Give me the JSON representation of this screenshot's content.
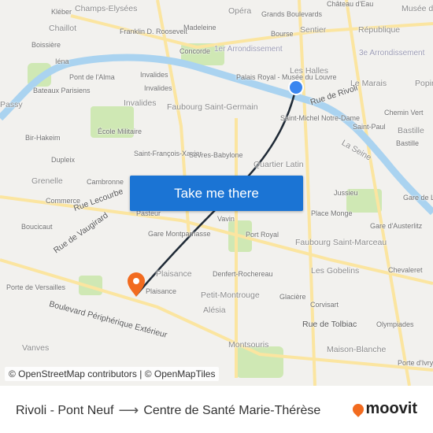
{
  "map": {
    "labels": [
      "Kléber",
      "Champs-Elysées",
      "Opéra",
      "Grands Boulevards",
      "Château d'Eau",
      "Musée du Temple",
      "Chaillot",
      "Franklin D. Roosevelt",
      "Madeleine",
      "Bourse",
      "Sentier",
      "République",
      "Boissière",
      "Concorde",
      "1er Arrondissement",
      "3e Arrondissement",
      "Iéna",
      "Les Halles",
      "Pont de l'Alma",
      "Invalides",
      "Invalides",
      "Palais Royal - Musée du Louvre",
      "Le Marais",
      "Bateaux Parisiens",
      "Rue de Rivoli",
      "Invalides",
      "Faubourg Saint-Germain",
      "Chemin Vert",
      "Saint-Paul",
      "Bastille",
      "Bir-Hakeim",
      "École Militaire",
      "Saint-Michel Notre-Dame",
      "Bastille",
      "La Seine",
      "Dupleix",
      "Saint-François-Xavier",
      "Sèvres-Babylone",
      "Quartier Latin",
      "Grenelle",
      "Cambronne",
      "Jussieu",
      "Commerce",
      "Rue Lecourbe",
      "Pasteur",
      "Place Monge",
      "Gare de Lyon",
      "Boucicaut",
      "Vavin",
      "Gare d'Austerlitz",
      "Gare Montparnasse",
      "Port Royal",
      "Rue de Vaugirard",
      "Faubourg Saint-Marceau",
      "Chevaleret",
      "Plaisance",
      "Denfert-Rochereau",
      "Les Gobelins",
      "Porte de Versailles",
      "Plaisance",
      "Petit-Montrouge",
      "Glacière",
      "Corvisart",
      "Alésia",
      "Boulevard Périphérique Extérieur",
      "Rue de Tolbiac",
      "Olympiades",
      "Vanves",
      "Montsouris",
      "Maison-Blanche",
      "Porte d'Ivry",
      "Passy",
      "Popincourt"
    ],
    "colors": {
      "river": "#aad3f0",
      "park": "#cfe8b4",
      "road_major": "#fbe5a0",
      "route": "#1f2a36",
      "origin": "#3a86f0",
      "destination": "#f26b1f"
    },
    "origin_icon": "origin-dot-icon",
    "destination_icon": "destination-pin-icon"
  },
  "cta": {
    "label": "Take me there"
  },
  "attribution": "© OpenStreetMap contributors | © OpenMapTiles",
  "footer": {
    "from": "Rivoli - Pont Neuf",
    "arrow_icon": "arrow-right-icon",
    "to": "Centre de Santé Marie-Thérèse",
    "logo": "moovit"
  }
}
